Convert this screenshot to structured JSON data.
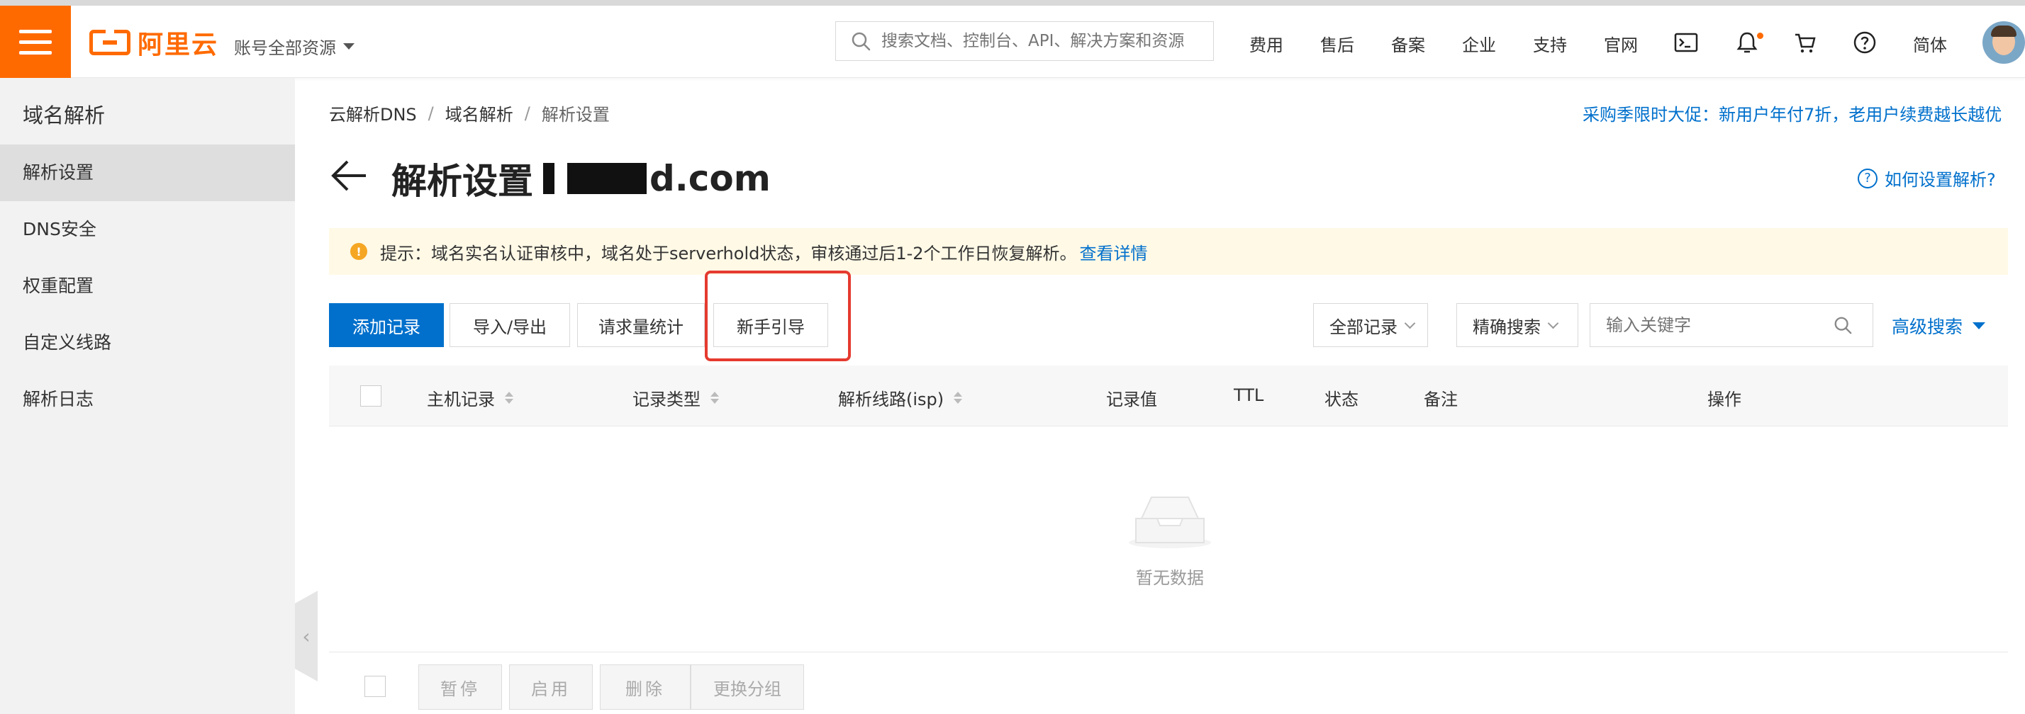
{
  "header": {
    "logo_text": "阿里云",
    "account_label": "账号全部资源",
    "search_placeholder": "搜索文档、控制台、API、解决方案和资源",
    "nav": {
      "fee": "费用",
      "after_sale": "售后",
      "record": "备案",
      "enterprise": "企业",
      "support": "支持",
      "official": "官网",
      "lang": "简体"
    }
  },
  "sidebar": {
    "title": "域名解析",
    "items": [
      {
        "label": "解析设置",
        "active": true
      },
      {
        "label": "DNS安全"
      },
      {
        "label": "权重配置"
      },
      {
        "label": "自定义线路"
      },
      {
        "label": "解析日志"
      }
    ]
  },
  "breadcrumb": [
    "云解析DNS",
    "域名解析",
    "解析设置"
  ],
  "breadcrumb_sep": "/",
  "promo": "采购季限时大促：新用户年付7折，老用户续费越长越优",
  "page": {
    "title": "解析设置",
    "domain_visible_tail": "d.com",
    "help_link": "如何设置解析?"
  },
  "notice": {
    "icon": "!",
    "text": "提示：域名实名认证审核中，域名处于serverhold状态，审核通过后1-2个工作日恢复解析。",
    "link": "查看详情"
  },
  "toolbar": {
    "add": "添加记录",
    "import_export": "导入/导出",
    "stats": "请求量统计",
    "guide": "新手引导",
    "filter_records": "全部记录",
    "exact_search": "精确搜索",
    "keyword_placeholder": "输入关键字",
    "advanced_search": "高级搜索"
  },
  "table": {
    "columns": [
      "主机记录",
      "记录类型",
      "解析线路(isp)",
      "记录值",
      "TTL",
      "状态",
      "备注",
      "操作"
    ],
    "rows": [],
    "empty_text": "暂无数据"
  },
  "bottom_actions": [
    "暂停",
    "启用",
    "删除",
    "更换分组"
  ],
  "colors": {
    "brand_orange": "#ff6a00",
    "primary_blue": "#0070cc",
    "highlight_red": "#e53a2f"
  }
}
